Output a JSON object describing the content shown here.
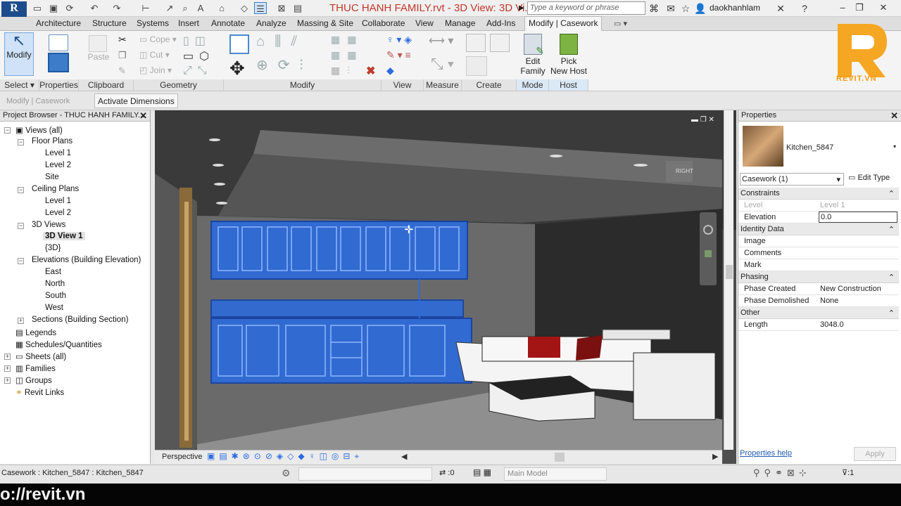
{
  "app": {
    "logo_letter": "R",
    "title": "THUC HANH FAMILY.rvt - 3D View: 3D Vi...",
    "search_placeholder": "Type a keyword or phrase",
    "user": "daokhanhlam"
  },
  "tabs": [
    "Architecture",
    "Structure",
    "Systems",
    "Insert",
    "Annotate",
    "Analyze",
    "Massing & Site",
    "Collaborate",
    "View",
    "Manage",
    "Add-Ins",
    "Modify | Casework"
  ],
  "ribbon": {
    "modify_label": "Modify",
    "properties_label": "Properties",
    "paste_label": "Paste",
    "copy_label": "Cope",
    "cut_label": "Cut",
    "join_label": "Join",
    "edit_family_label_1": "Edit",
    "edit_family_label_2": "Family",
    "pick_host_label_1": "Pick",
    "pick_host_label_2": "New Host",
    "panels": [
      "Select",
      "Properties",
      "Clipboard",
      "Geometry",
      "Modify",
      "View",
      "Measure",
      "Create",
      "Mode",
      "Host"
    ]
  },
  "options_bar": {
    "context": "Modify | Casework",
    "activate_dimensions": "Activate Dimensions"
  },
  "project_browser": {
    "title": "Project Browser - THUC HANH FAMILY....",
    "nodes": {
      "views_all": "Views (all)",
      "floor_plans": "Floor Plans",
      "fp_level1": "Level 1",
      "fp_level2": "Level 2",
      "fp_site": "Site",
      "ceiling_plans": "Ceiling Plans",
      "cp_level1": "Level 1",
      "cp_level2": "Level 2",
      "views_3d": "3D Views",
      "view_3d1": "3D View 1",
      "view_3d": "{3D}",
      "elevations": "Elevations (Building Elevation)",
      "east": "East",
      "north": "North",
      "south": "South",
      "west": "West",
      "sections": "Sections (Building Section)",
      "legends": "Legends",
      "schedules": "Schedules/Quantities",
      "sheets": "Sheets (all)",
      "families": "Families",
      "groups": "Groups",
      "revit_links": "Revit Links"
    }
  },
  "viewport": {
    "view_mode": "Perspective",
    "viewcube_label": "RIGHT"
  },
  "properties": {
    "title": "Properties",
    "type_name": "Kitchen_5847",
    "selector": "Casework (1)",
    "edit_type": "Edit Type",
    "groups": {
      "constraints": "Constraints",
      "identity": "Identity Data",
      "phasing": "Phasing",
      "other": "Other"
    },
    "rows": {
      "level_k": "Level",
      "level_v": "Level 1",
      "elev_k": "Elevation",
      "elev_v": "0.0",
      "image_k": "Image",
      "image_v": "",
      "comments_k": "Comments",
      "comments_v": "",
      "mark_k": "Mark",
      "mark_v": "",
      "phase_created_k": "Phase Created",
      "phase_created_v": "New Construction",
      "phase_demo_k": "Phase Demolished",
      "phase_demo_v": "None",
      "length_k": "Length",
      "length_v": "3048.0"
    },
    "help": "Properties help",
    "apply": "Apply"
  },
  "status": {
    "selection": "Casework : Kitchen_5847 : Kitchen_5847",
    "filter_count": ":0",
    "model": "Main Model",
    "sel_count": "1"
  },
  "watermark": {
    "brand": "REVIT.VN",
    "url": "o://revit.vn"
  },
  "colors": {
    "selection_blue": "#2a6be0",
    "accent_orange": "#f39c12",
    "title_red": "#c0392b"
  }
}
